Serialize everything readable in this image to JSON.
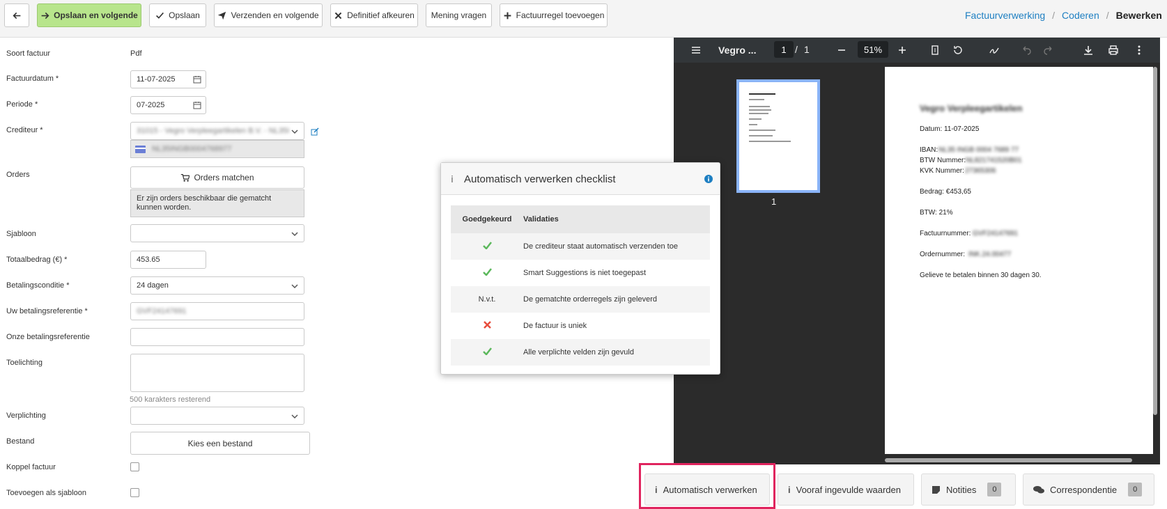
{
  "toolbar": {
    "back_label": "",
    "save_next": "Opslaan en volgende",
    "save": "Opslaan",
    "send_next": "Verzenden en volgende",
    "reject": "Definitief afkeuren",
    "opinion": "Mening vragen",
    "add_line": "Factuurregel toevoegen"
  },
  "breadcrumb": [
    "Factuurverwerking",
    "Coderen",
    "Bewerken"
  ],
  "form": {
    "invoice_type_label": "Soort factuur",
    "invoice_type_value": "Pdf",
    "invoice_date_label": "Factuurdatum *",
    "invoice_date_value": "11-07-2025",
    "period_label": "Periode *",
    "period_value": "07-2025",
    "creditor_label": "Crediteur *",
    "creditor_value": "31015 - Vegro Verpleegartikelen B.V. - NL35I",
    "creditor_iban": "NL35INGB0004768977",
    "orders_label": "Orders",
    "orders_button": "Orders matchen",
    "orders_note": "Er zijn orders beschikbaar die gematcht kunnen worden.",
    "template_label": "Sjabloon",
    "template_value": "",
    "total_label": "Totaalbedrag (€) *",
    "total_value": "453.65",
    "payment_condition_label": "Betalingsconditie *",
    "payment_condition_value": "24 dagen",
    "your_ref_label": "Uw betalingsreferentie *",
    "your_ref_value": "GVF24147691",
    "our_ref_label": "Onze betalingsreferentie",
    "our_ref_value": "",
    "explanation_label": "Toelichting",
    "explanation_value": "",
    "chars_remaining": "500 karakters resterend",
    "obligation_label": "Verplichting",
    "obligation_value": "",
    "file_label": "Bestand",
    "file_button": "Kies een bestand",
    "link_invoice_label": "Koppel factuur",
    "add_template_label": "Toevoegen als sjabloon"
  },
  "pdf": {
    "title": "Vegro ...",
    "page_current": "1",
    "page_sep": "/",
    "page_total": "1",
    "zoom": "51%",
    "thumb_label": "1",
    "doc": {
      "heading": "Vegro Verpleegartikelen",
      "date": "Datum: 11-07-2025",
      "iban_label": "IBAN:",
      "iban_value": "NL35 INGB 0004 7689 77",
      "btw_label": "BTW Nummer:",
      "btw_value": "NL821741520B01",
      "kvk_label": "KVK Nummer:",
      "kvk_value": "27365306",
      "amount": "Bedrag: €453,65",
      "vat": "BTW: 21%",
      "invoice_no_label": "Factuurnummer:",
      "invoice_no_value": "GVF24147691",
      "order_no_label": "Ordernummer:",
      "order_no_value": "INK.24.00477",
      "pay_note": "Gelieve te betalen binnen 30 dagen 30."
    }
  },
  "modal": {
    "title": "Automatisch verwerken checklist",
    "col_approved": "Goedgekeurd",
    "col_validations": "Validaties",
    "rows": [
      {
        "status": "check",
        "text": "De crediteur staat automatisch verzenden toe"
      },
      {
        "status": "check",
        "text": "Smart Suggestions is niet toegepast"
      },
      {
        "status": "N.v.t.",
        "text": "De gematchte orderregels zijn geleverd"
      },
      {
        "status": "cross",
        "text": "De factuur is uniek"
      },
      {
        "status": "check",
        "text": "Alle verplichte velden zijn gevuld"
      }
    ]
  },
  "tabs": {
    "auto": "Automatisch verwerken",
    "prefilled": "Vooraf ingevulde waarden",
    "notes": "Notities",
    "notes_count": "0",
    "correspondence": "Correspondentie",
    "correspondence_count": "0"
  },
  "colors": {
    "accent": "#1e7fc2",
    "primary_button": "#b8e58c",
    "highlight": "#e0245e",
    "check": "#5cb85c",
    "cross": "#e74c3c"
  }
}
